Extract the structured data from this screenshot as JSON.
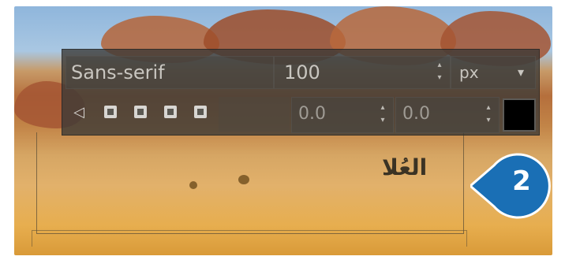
{
  "toolbar": {
    "font_family": "Sans-serif",
    "font_size": "100",
    "unit": "px",
    "offset_x": "0.0",
    "offset_y": "0.0",
    "text_color": "#000000"
  },
  "canvas": {
    "text": "العُلا"
  },
  "callout": {
    "number": "2",
    "color": "#1a6fb5"
  },
  "icons": [
    "back-arrow-icon",
    "align-icon",
    "align-icon",
    "align-icon",
    "align-icon",
    "chevron-down-icon",
    "spin-up-icon",
    "spin-down-icon"
  ]
}
